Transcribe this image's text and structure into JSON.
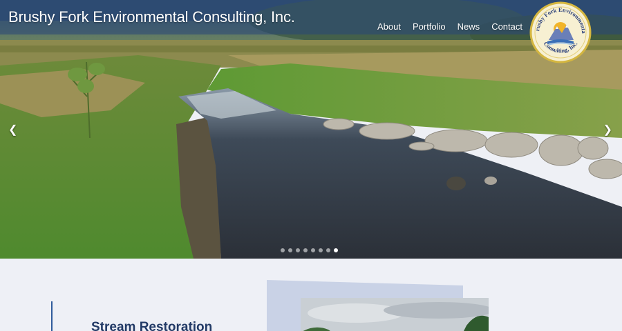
{
  "header": {
    "site_title": "Brushy Fork Environmental Consulting, Inc.",
    "nav": [
      {
        "label": "About"
      },
      {
        "label": "Portfolio"
      },
      {
        "label": "News"
      },
      {
        "label": "Contact"
      }
    ]
  },
  "logo": {
    "text_top": "Brushy Fork Environmental",
    "text_bottom": "Consulting, Inc."
  },
  "slider": {
    "prev_icon": "chevron-left-icon",
    "next_icon": "chevron-right-icon",
    "slide_count": 8,
    "active_slide": 8
  },
  "section": {
    "heading": "Stream Restoration"
  },
  "colors": {
    "topbar": "#2c4d80",
    "heading": "#223a66",
    "accent": "#2f5b9c",
    "background": "#eef0f6"
  }
}
